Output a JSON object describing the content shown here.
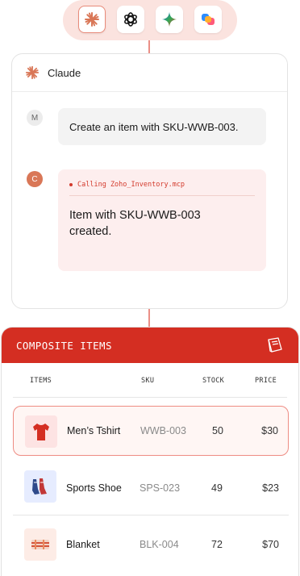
{
  "switcher": {
    "apps": [
      {
        "name": "claude",
        "icon": "claude-starburst-icon",
        "active": true
      },
      {
        "name": "chatgpt",
        "icon": "openai-knot-icon",
        "active": false
      },
      {
        "name": "gemini",
        "icon": "gemini-sparkle-icon",
        "active": false
      },
      {
        "name": "copilot",
        "icon": "copilot-icon",
        "active": false
      }
    ]
  },
  "chat": {
    "assistant_name": "Claude",
    "user_initial": "M",
    "assistant_initial": "C",
    "user_message": "Create an item with SKU-WWB-003.",
    "tool_call": "Calling Zoho_Inventory.mcp",
    "assistant_reply": "Item with SKU-WWB-003 created."
  },
  "panel": {
    "title": "COMPOSITE ITEMS",
    "icon": "book-icon",
    "columns": {
      "items": "ITEMS",
      "sku": "SKU",
      "stock": "STOCK",
      "price": "PRICE"
    },
    "rows": [
      {
        "name": "Men’s Tshirt",
        "sku": "WWB-003",
        "stock": "50",
        "price": "$30",
        "selected": true
      },
      {
        "name": "Sports Shoe",
        "sku": "SPS-023",
        "stock": "49",
        "price": "$23",
        "selected": false
      },
      {
        "name": "Blanket",
        "sku": "BLK-004",
        "stock": "72",
        "price": "$70",
        "selected": false
      }
    ]
  },
  "colors": {
    "accent": "#d42e22",
    "pill": "#fbe3df",
    "claude": "#d97757"
  }
}
